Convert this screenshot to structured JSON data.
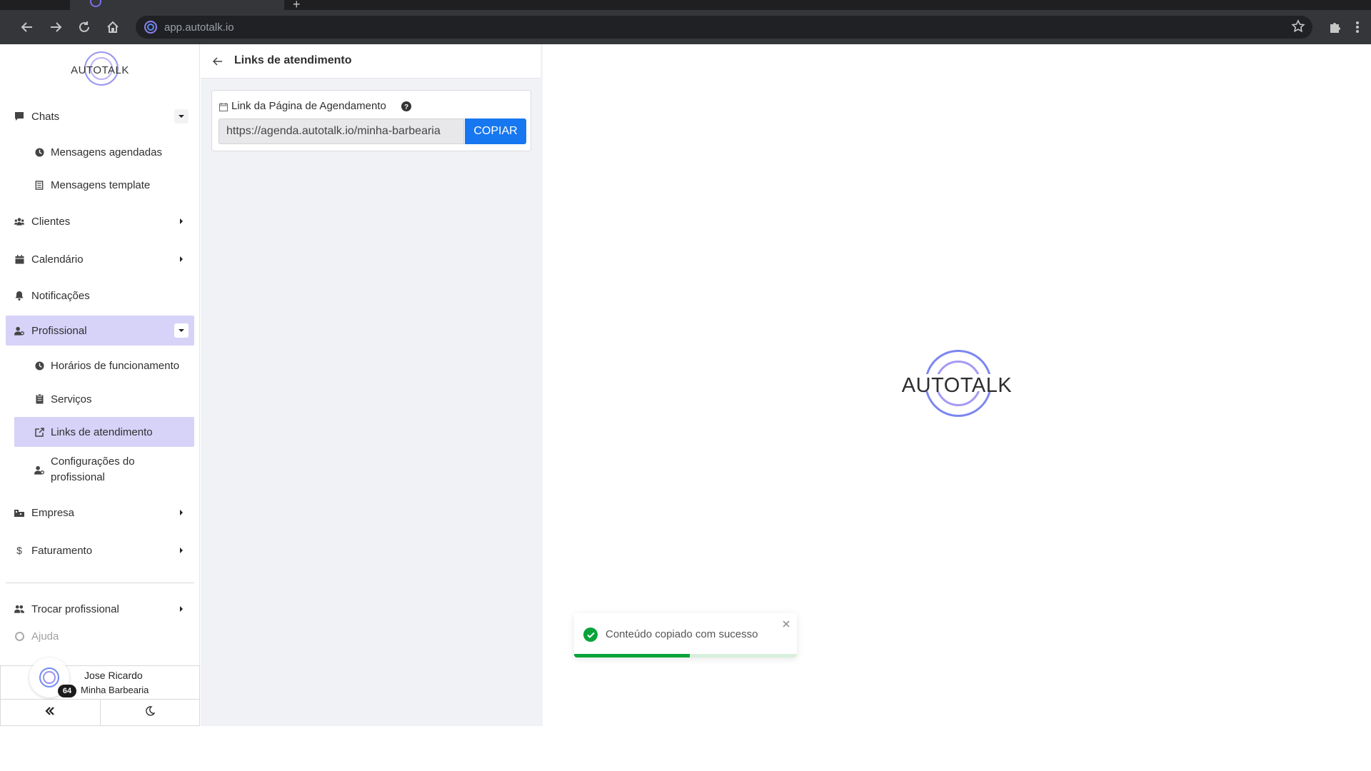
{
  "browser": {
    "url": "app.autotalk.io",
    "new_tab_symbol": "+"
  },
  "sidebar": {
    "logo_text": "AUTOTALK",
    "items": [
      {
        "label": "Chats",
        "icon": "chat-icon"
      },
      {
        "label": "Mensagens agendadas",
        "icon": "clock-icon"
      },
      {
        "label": "Mensagens template",
        "icon": "template-icon"
      },
      {
        "label": "Clientes",
        "icon": "users-icon"
      },
      {
        "label": "Calendário",
        "icon": "calendar-icon"
      },
      {
        "label": "Notificações",
        "icon": "bell-icon"
      },
      {
        "label": "Profissional",
        "icon": "user-cog-icon"
      },
      {
        "label": "Horários de funcionamento",
        "icon": "clock-icon"
      },
      {
        "label": "Serviços",
        "icon": "clipboard-icon"
      },
      {
        "label": "Links de atendimento",
        "icon": "external-link-icon"
      },
      {
        "label": "Configurações do profissional",
        "icon": "user-cog-icon"
      },
      {
        "label": "Empresa",
        "icon": "building-icon"
      },
      {
        "label": "Faturamento",
        "icon": "dollar-icon"
      },
      {
        "label": "Trocar profissional",
        "icon": "users-swap-icon"
      },
      {
        "label": "Ajuda",
        "icon": "help-circle-icon"
      }
    ],
    "user": {
      "name": "Jose Ricardo",
      "company": "Minha Barbearia",
      "badge_count": "64"
    }
  },
  "panel": {
    "title": "Links de atendimento",
    "card_label": "Link da Página de Agendamento",
    "link_value": "https://agenda.autotalk.io/minha-barbearia",
    "copy_label": "COPIAR"
  },
  "main": {
    "logo_text": "AUTOTALK"
  },
  "toast": {
    "message": "Conteúdo copiado com sucesso",
    "progress": 0.52
  },
  "colors": {
    "accent": "#d7d2f8",
    "primary_button": "#1677f0",
    "success": "#08a33a"
  }
}
